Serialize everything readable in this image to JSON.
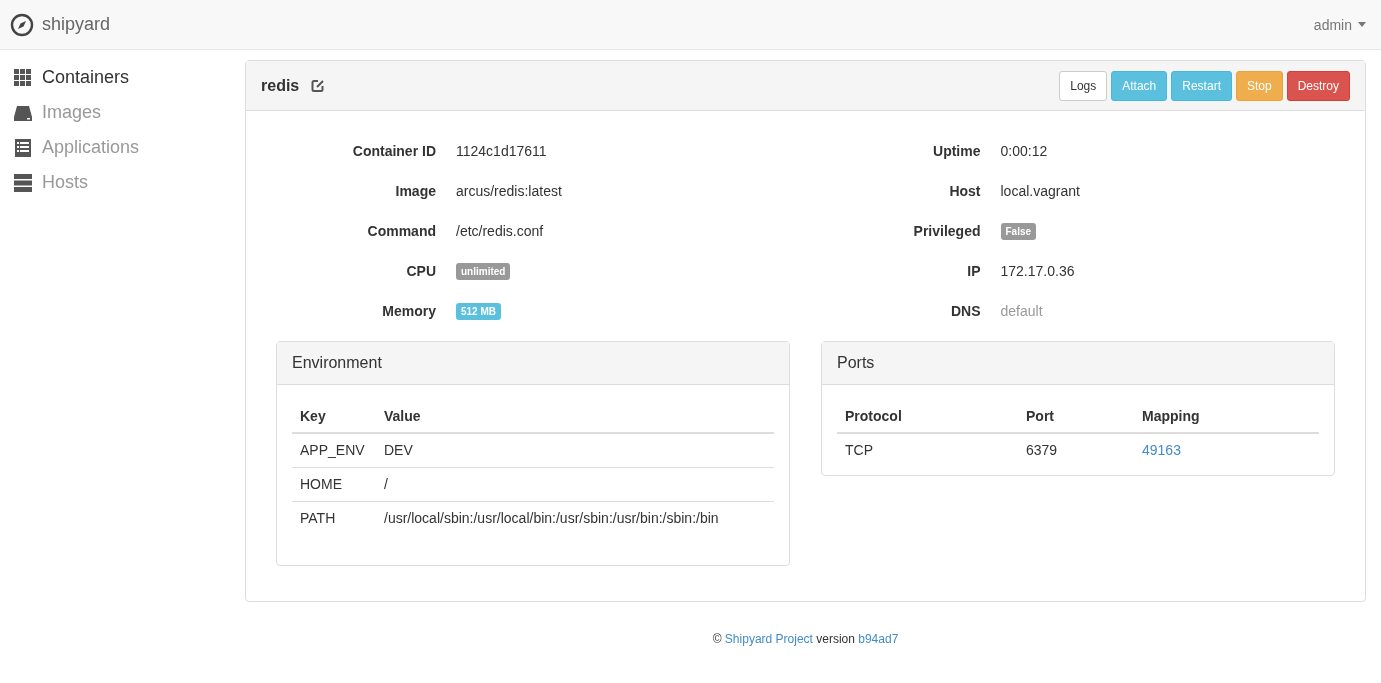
{
  "navbar": {
    "brand": "shipyard",
    "user": "admin"
  },
  "sidebar": {
    "items": [
      {
        "label": "Containers",
        "kind": "grid",
        "selected": true
      },
      {
        "label": "Images",
        "kind": "drive",
        "selected": false
      },
      {
        "label": "Applications",
        "kind": "list",
        "selected": false
      },
      {
        "label": "Hosts",
        "kind": "server",
        "selected": false
      }
    ]
  },
  "container": {
    "name": "redis",
    "buttons": [
      {
        "label": "Logs",
        "kind": "default"
      },
      {
        "label": "Attach",
        "kind": "info"
      },
      {
        "label": "Restart",
        "kind": "info"
      },
      {
        "label": "Stop",
        "kind": "warning"
      },
      {
        "label": "Destroy",
        "kind": "danger"
      }
    ],
    "details_left": [
      {
        "label": "Container ID",
        "value": "1124c1d17611",
        "kind": "text"
      },
      {
        "label": "Image",
        "value": "arcus/redis:latest",
        "kind": "text"
      },
      {
        "label": "Command",
        "value": "/etc/redis.conf",
        "kind": "text"
      },
      {
        "label": "CPU",
        "value": "unlimited",
        "kind": "badge",
        "color": "#999999"
      },
      {
        "label": "Memory",
        "value": "512 MB",
        "kind": "badge",
        "color": "#5bc0de"
      }
    ],
    "details_right": [
      {
        "label": "Uptime",
        "value": "0:00:12",
        "kind": "text"
      },
      {
        "label": "Host",
        "value": "local.vagrant",
        "kind": "text"
      },
      {
        "label": "Privileged",
        "value": "False",
        "kind": "badge",
        "color": "#999999"
      },
      {
        "label": "IP",
        "value": "172.17.0.36",
        "kind": "text"
      },
      {
        "label": "DNS",
        "value": "default",
        "kind": "muted"
      }
    ],
    "environment": {
      "title": "Environment",
      "columns": [
        "Key",
        "Value"
      ],
      "rows": [
        [
          "APP_ENV",
          "DEV"
        ],
        [
          "HOME",
          "/"
        ],
        [
          "PATH",
          "/usr/local/sbin:/usr/local/bin:/usr/sbin:/usr/bin:/sbin:/bin"
        ]
      ]
    },
    "ports": {
      "title": "Ports",
      "columns": [
        "Protocol",
        "Port",
        "Mapping"
      ],
      "rows": [
        {
          "protocol": "TCP",
          "port": "6379",
          "mapping": "49163"
        }
      ]
    }
  },
  "footer": {
    "symbol": "©",
    "project_link": "Shipyard Project",
    "version_label": "version",
    "version_link": "b94ad7"
  }
}
